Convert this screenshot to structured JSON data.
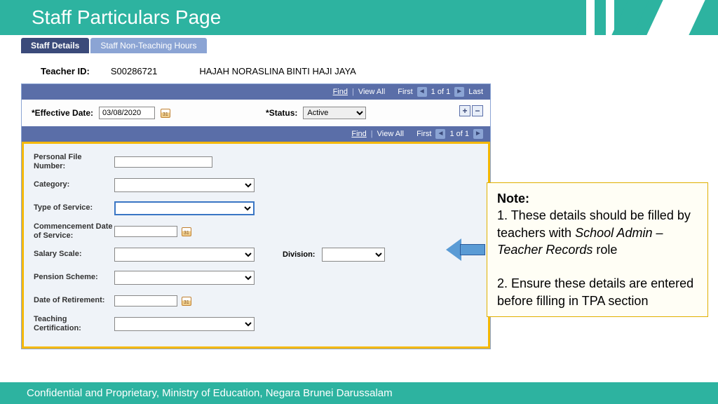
{
  "header": {
    "title": "Staff Particulars Page"
  },
  "tabs": {
    "details": "Staff Details",
    "nonteaching": "Staff Non-Teaching Hours"
  },
  "teacher": {
    "id_label": "Teacher ID:",
    "id": "S00286721",
    "name": "HAJAH NORASLINA BINTI HAJI JAYA"
  },
  "nav": {
    "find": "Find",
    "viewall": "View All",
    "first": "First",
    "count": "1 of 1",
    "last": "Last"
  },
  "eff": {
    "date_label": "*Effective Date:",
    "date": "03/08/2020",
    "status_label": "*Status:",
    "status": "Active"
  },
  "form": {
    "pfn": "Personal File Number:",
    "category": "Category:",
    "tos": "Type of Service:",
    "cdos": "Commencement Date of Service:",
    "salary": "Salary Scale:",
    "division": "Division:",
    "pension": "Pension Scheme:",
    "retire": "Date of Retirement:",
    "cert": "Teaching Certification:"
  },
  "note": {
    "heading": "Note:",
    "l1a": "1. These details should be filled by teachers with ",
    "l1b": "School Admin – Teacher Records",
    "l1c": " role",
    "l2": "2. Ensure these details are entered before filling in TPA section"
  },
  "footer": "Confidential and Proprietary, Ministry of Education, Negara Brunei Darussalam"
}
